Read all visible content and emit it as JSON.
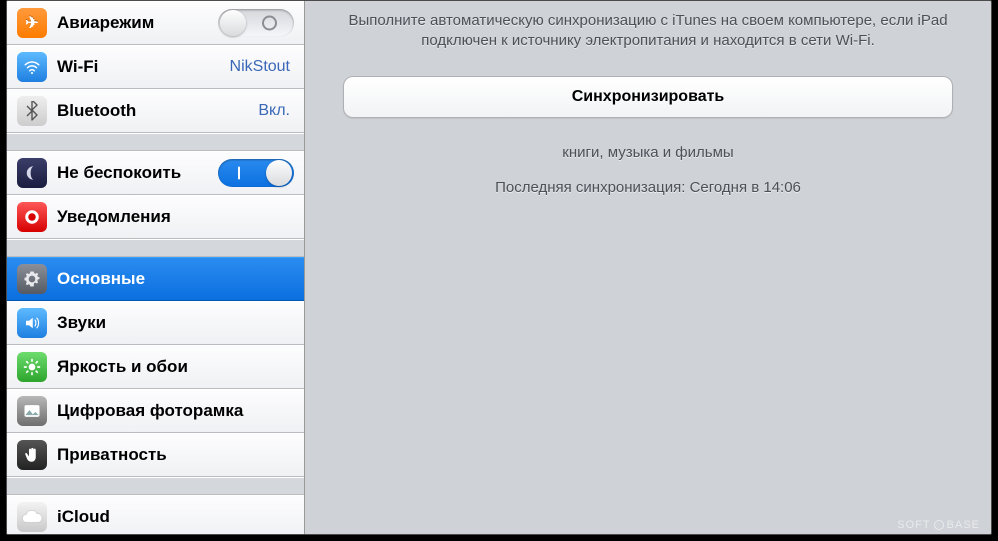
{
  "sidebar": {
    "items": [
      {
        "label": "Авиарежим",
        "toggle": "off"
      },
      {
        "label": "Wi-Fi",
        "value": "NikStout"
      },
      {
        "label": "Bluetooth",
        "value": "Вкл."
      },
      {
        "label": "Не беспокоить",
        "toggle": "on"
      },
      {
        "label": "Уведомления"
      },
      {
        "label": "Основные"
      },
      {
        "label": "Звуки"
      },
      {
        "label": "Яркость и обои"
      },
      {
        "label": "Цифровая фоторамка"
      },
      {
        "label": "Приватность"
      },
      {
        "label": "iCloud"
      }
    ]
  },
  "main": {
    "description": "Выполните автоматическую синхронизацию с iTunes на своем компьютере, если iPad подключен к источнику электропитания и находится в сети Wi-Fi.",
    "sync_button": "Синхронизировать",
    "content_types": "книги, музыка и фильмы",
    "last_sync": "Последняя синхронизация: Сегодня в 14:06"
  },
  "watermark": {
    "left": "SOFT",
    "right": "BASE"
  }
}
